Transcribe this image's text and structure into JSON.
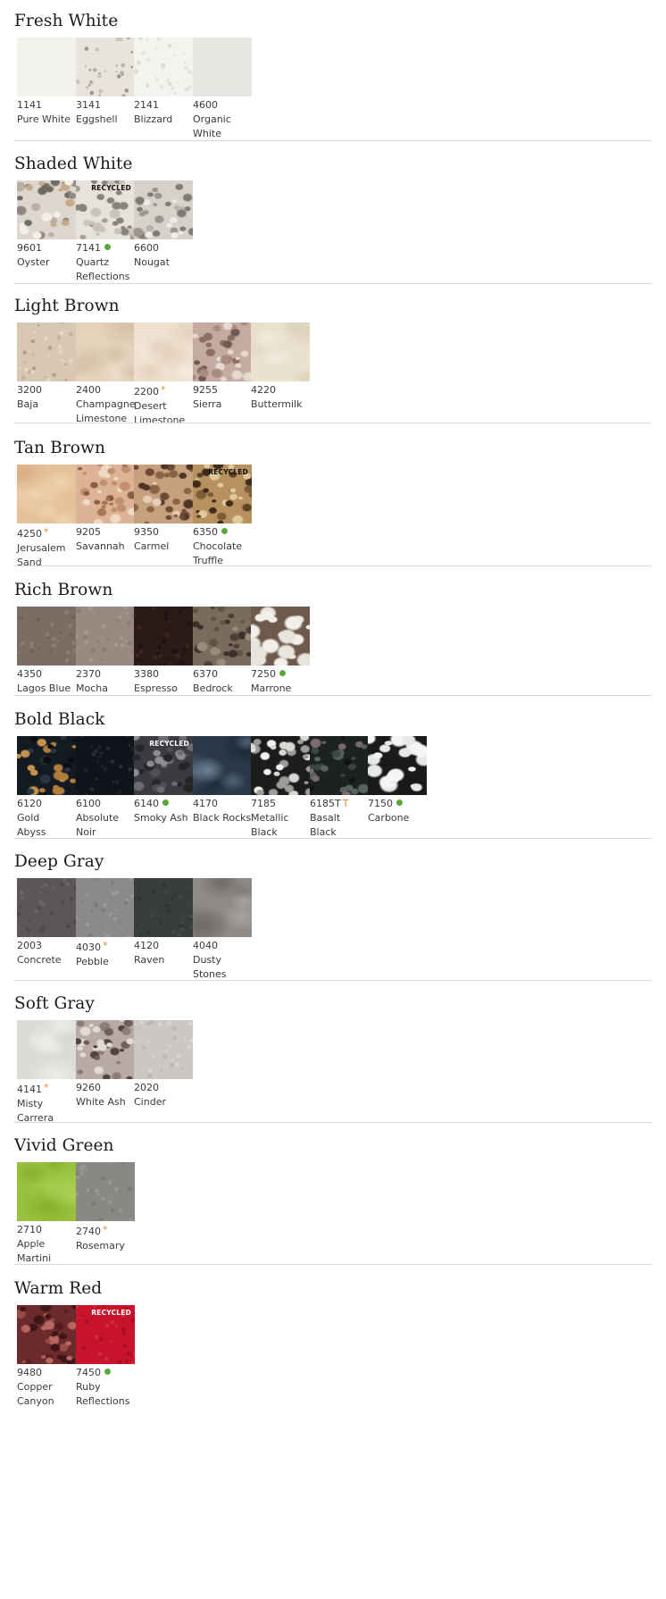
{
  "sections": [
    {
      "title": "Fresh White",
      "swatches": [
        {
          "code": "1141",
          "name": "Pure White",
          "mark": "",
          "recycled": false,
          "color": "#f2f1ec",
          "tex": "plain"
        },
        {
          "code": "3141",
          "name": "Eggshell",
          "mark": "",
          "recycled": false,
          "color": "#e8e4dc",
          "tex": "fine",
          "speck": [
            "#b8b2a6",
            "#c9c4ba",
            "#9f998d"
          ]
        },
        {
          "code": "2141",
          "name": "Blizzard",
          "mark": "",
          "recycled": false,
          "color": "#f3f4ef",
          "tex": "fine",
          "speck": [
            "#e3e4de",
            "#dcddd6"
          ]
        },
        {
          "code": "4600",
          "name": "Organic\nWhite",
          "mark": "",
          "recycled": false,
          "color": "#e8e6e3",
          "tex": "plain"
        }
      ]
    },
    {
      "title": "Shaded White",
      "swatches": [
        {
          "code": "9601",
          "name": "Oyster",
          "mark": "",
          "recycled": false,
          "color": "#dcd6cd",
          "tex": "chip",
          "speck": [
            "#8f887e",
            "#b9b0a4",
            "#f3efe8",
            "#6f6a63",
            "#c6a98a"
          ]
        },
        {
          "code": "7141",
          "name": "Quartz\nReflections",
          "mark": "dot",
          "recycled": true,
          "recycledText": "RECYCLED",
          "recycledColor": "#111111",
          "color": "#e6e2dc",
          "tex": "chip",
          "speck": [
            "#a59e95",
            "#c9c3bb",
            "#8a837a"
          ]
        },
        {
          "code": "6600",
          "name": "Nougat",
          "mark": "",
          "recycled": false,
          "color": "#d6d1cb",
          "tex": "chip",
          "speck": [
            "#9b958e",
            "#b8b2ab",
            "#efebe6",
            "#7f7a74"
          ]
        }
      ]
    },
    {
      "title": "Light Brown",
      "swatches": [
        {
          "code": "3200",
          "name": "Baja",
          "mark": "",
          "recycled": false,
          "color": "#d8c8b3",
          "tex": "fine",
          "speck": [
            "#c4b29b",
            "#e6d8c6",
            "#b59f86"
          ]
        },
        {
          "code": "2400",
          "name": "Champagne\nLimestone",
          "mark": "",
          "recycled": false,
          "color": "#e4d2bb",
          "tex": "cloud",
          "speck": [
            "#d5c1a7",
            "#efe1ce"
          ]
        },
        {
          "code": "2200",
          "name": "Desert\nLimestone",
          "mark": "star",
          "recycled": false,
          "color": "#efe0cf",
          "tex": "cloud",
          "speck": [
            "#e3d1bd",
            "#f6ece0"
          ]
        },
        {
          "code": "9255",
          "name": "Sierra",
          "mark": "",
          "recycled": false,
          "color": "#c5ab9f",
          "tex": "chip",
          "speck": [
            "#8c6f63",
            "#e7d9d1",
            "#a88b7e",
            "#6e5850"
          ]
        },
        {
          "code": "4220",
          "name": "Buttermilk",
          "mark": "",
          "recycled": false,
          "color": "#eae1cf",
          "tex": "cloud",
          "speck": [
            "#ddd2bc",
            "#f3ecdf"
          ]
        }
      ]
    },
    {
      "title": "Tan Brown",
      "swatches": [
        {
          "code": "4250",
          "name": "Jerusalem\nSand",
          "mark": "star",
          "recycled": false,
          "color": "#e6c29a",
          "tex": "cloud",
          "speck": [
            "#d8ae84",
            "#f0d3b2"
          ]
        },
        {
          "code": "9205",
          "name": "Savannah",
          "mark": "",
          "recycled": false,
          "color": "#dcb394",
          "tex": "chip",
          "speck": [
            "#a87455",
            "#f0d9c7",
            "#c08f70",
            "#8a5c44"
          ]
        },
        {
          "code": "9350",
          "name": "Carmel",
          "mark": "",
          "recycled": false,
          "color": "#c7a07f",
          "tex": "chip",
          "speck": [
            "#6c4a33",
            "#e5cdb6",
            "#8a6244",
            "#4d3424"
          ]
        },
        {
          "code": "6350",
          "name": "Chocolate\nTruffle",
          "mark": "dot",
          "recycled": true,
          "recycledText": "RECYCLED",
          "recycledColor": "#111111",
          "color": "#b7915f",
          "tex": "chip",
          "speck": [
            "#5b4126",
            "#e2c99b",
            "#7d5c36",
            "#3e2b18"
          ]
        }
      ]
    },
    {
      "title": "Rich Brown",
      "swatches": [
        {
          "code": "4350",
          "name": "Lagos Blue",
          "mark": "",
          "recycled": false,
          "color": "#7b6d63",
          "tex": "fine",
          "speck": [
            "#6e6158",
            "#8a7d73"
          ]
        },
        {
          "code": "2370",
          "name": "Mocha",
          "mark": "",
          "recycled": false,
          "color": "#988a80",
          "tex": "fine",
          "speck": [
            "#8a7c72",
            "#a69990"
          ]
        },
        {
          "code": "3380",
          "name": "Espresso",
          "mark": "",
          "recycled": false,
          "color": "#2b1a17",
          "tex": "fine",
          "speck": [
            "#3b2723",
            "#1f1210"
          ]
        },
        {
          "code": "6370",
          "name": "Bedrock",
          "mark": "",
          "recycled": false,
          "color": "#7a6c5d",
          "tex": "chip",
          "speck": [
            "#4a4035",
            "#9a8b7b",
            "#5f5447",
            "#3a3128"
          ]
        },
        {
          "code": "7250",
          "name": "Marrone",
          "mark": "dot",
          "recycled": false,
          "color": "#6e5a4d",
          "tex": "big",
          "speck": [
            "#f2efea",
            "#e9e4dc"
          ]
        }
      ]
    },
    {
      "title": "Bold Black",
      "swatches": [
        {
          "code": "6120",
          "name": "Gold\nAbyss",
          "mark": "",
          "recycled": false,
          "color": "#141a22",
          "tex": "chip",
          "speck": [
            "#b07d3d",
            "#2b3441",
            "#c49350",
            "#0a0e13"
          ]
        },
        {
          "code": "6100",
          "name": "Absolute\nNoir",
          "mark": "",
          "recycled": false,
          "color": "#10141a",
          "tex": "fine",
          "speck": [
            "#1d232b",
            "#262d36"
          ]
        },
        {
          "code": "6140",
          "name": "Smoky Ash",
          "mark": "dot",
          "recycled": true,
          "recycledText": "RECYCLED",
          "recycledColor": "#ffffff",
          "color": "#3a3c3f",
          "tex": "chip",
          "speck": [
            "#6a6c6f",
            "#232527",
            "#8b8d90",
            "#4e5053"
          ]
        },
        {
          "code": "4170",
          "name": "Black Rocks",
          "mark": "",
          "recycled": false,
          "color": "#2a3847",
          "tex": "cloud",
          "speck": [
            "#4f6378",
            "#1a2430",
            "#6b7f93"
          ]
        },
        {
          "code": "7185",
          "name": "Metallic\nBlack",
          "mark": "",
          "recycled": false,
          "color": "#1b1c1c",
          "tex": "chip",
          "speck": [
            "#d8d8d4",
            "#9c9c98",
            "#f2f2ee"
          ]
        },
        {
          "code": "6185T",
          "name": "Basalt Black",
          "mark": "T",
          "recycled": false,
          "color": "#1c2220",
          "tex": "chip",
          "speck": [
            "#3c4743",
            "#566460",
            "#0f1312",
            "#7b6a6e"
          ]
        },
        {
          "code": "7150",
          "name": "Carbone",
          "mark": "dot",
          "recycled": false,
          "color": "#1a1a1a",
          "tex": "big",
          "speck": [
            "#f5f5f5",
            "#e8e8e8"
          ]
        }
      ]
    },
    {
      "title": "Deep Gray",
      "swatches": [
        {
          "code": "2003",
          "name": "Concrete",
          "mark": "",
          "recycled": false,
          "color": "#5c5559",
          "tex": "fine",
          "speck": [
            "#4f484c",
            "#6a6367"
          ]
        },
        {
          "code": "4030",
          "name": "Pebble",
          "mark": "star",
          "recycled": false,
          "color": "#8a8a8b",
          "tex": "fine",
          "speck": [
            "#7c7c7d",
            "#999999"
          ]
        },
        {
          "code": "4120",
          "name": "Raven",
          "mark": "",
          "recycled": false,
          "color": "#383d3e",
          "tex": "fine",
          "speck": [
            "#2f3435",
            "#434849"
          ]
        },
        {
          "code": "4040",
          "name": "Dusty\nStones",
          "mark": "",
          "recycled": false,
          "color": "#8e8b87",
          "tex": "cloud",
          "speck": [
            "#6f6c68",
            "#a7a49f",
            "#7d7a76"
          ]
        }
      ]
    },
    {
      "title": "Soft Gray",
      "swatches": [
        {
          "code": "4141",
          "name": "Misty\nCarrera",
          "mark": "star",
          "recycled": false,
          "color": "#dcdcd7",
          "tex": "cloud",
          "speck": [
            "#c6c7c1",
            "#ececea"
          ]
        },
        {
          "code": "9260",
          "name": "White Ash",
          "mark": "",
          "recycled": false,
          "color": "#b8aaa4",
          "tex": "chip",
          "speck": [
            "#6d5f59",
            "#e4dad5",
            "#8d7d76",
            "#4f4440"
          ]
        },
        {
          "code": "2020",
          "name": "Cinder",
          "mark": "",
          "recycled": false,
          "color": "#cac7c4",
          "tex": "fine",
          "speck": [
            "#b9b6b3",
            "#d8d5d2"
          ]
        }
      ]
    },
    {
      "title": "Vivid Green",
      "swatches": [
        {
          "code": "2710",
          "name": "Apple\nMartini",
          "mark": "",
          "recycled": false,
          "color": "#98c23d",
          "tex": "cloud",
          "speck": [
            "#86b12f",
            "#a9cf53"
          ]
        },
        {
          "code": "2740",
          "name": "Rosemary",
          "mark": "star",
          "recycled": false,
          "color": "#888885",
          "tex": "fine",
          "speck": [
            "#7a7a77",
            "#969693"
          ]
        }
      ]
    },
    {
      "title": "Warm Red",
      "swatches": [
        {
          "code": "9480",
          "name": "Copper\nCanyon",
          "mark": "",
          "recycled": false,
          "color": "#6b2a2c",
          "tex": "chip",
          "speck": [
            "#9a4a47",
            "#3f1516",
            "#b8675f",
            "#521e20"
          ]
        },
        {
          "code": "7450",
          "name": "Ruby\nReflections",
          "mark": "dot",
          "recycled": true,
          "recycledText": "RECYCLED",
          "recycledColor": "#ffffff",
          "color": "#c8142a",
          "tex": "fine",
          "speck": [
            "#a80f22",
            "#d8283a"
          ]
        }
      ]
    }
  ]
}
